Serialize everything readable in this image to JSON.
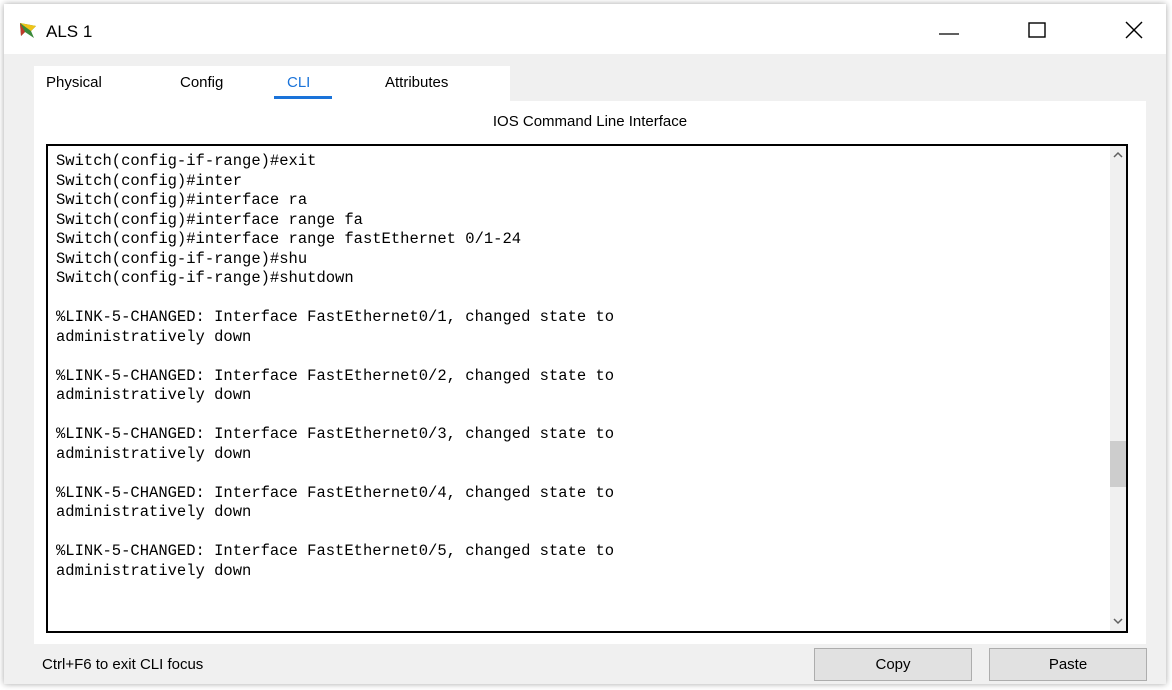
{
  "window": {
    "title": "ALS 1",
    "app_icon": "packet-tracer-switch-icon",
    "controls": [
      "minimize-icon",
      "maximize-icon",
      "close-icon"
    ]
  },
  "tabs": [
    {
      "label": "Physical",
      "active": false
    },
    {
      "label": "Config",
      "active": false
    },
    {
      "label": "CLI",
      "active": true
    },
    {
      "label": "Attributes",
      "active": false
    }
  ],
  "cli": {
    "header": "IOS Command Line Interface",
    "lines": [
      "Switch(config-if-range)#exit",
      "Switch(config)#inter",
      "Switch(config)#interface ra",
      "Switch(config)#interface range fa",
      "Switch(config)#interface range fastEthernet 0/1-24",
      "Switch(config-if-range)#shu",
      "Switch(config-if-range)#shutdown",
      "",
      "%LINK-5-CHANGED: Interface FastEthernet0/1, changed state to",
      "administratively down",
      "",
      "%LINK-5-CHANGED: Interface FastEthernet0/2, changed state to",
      "administratively down",
      "",
      "%LINK-5-CHANGED: Interface FastEthernet0/3, changed state to",
      "administratively down",
      "",
      "%LINK-5-CHANGED: Interface FastEthernet0/4, changed state to",
      "administratively down",
      "",
      "%LINK-5-CHANGED: Interface FastEthernet0/5, changed state to",
      "administratively down"
    ]
  },
  "footer": {
    "hint": "Ctrl+F6 to exit CLI focus",
    "copy_label": "Copy",
    "paste_label": "Paste"
  },
  "colors": {
    "accent": "#1a73d9",
    "window_bg": "#f0f0f0",
    "terminal_border": "#000000"
  }
}
